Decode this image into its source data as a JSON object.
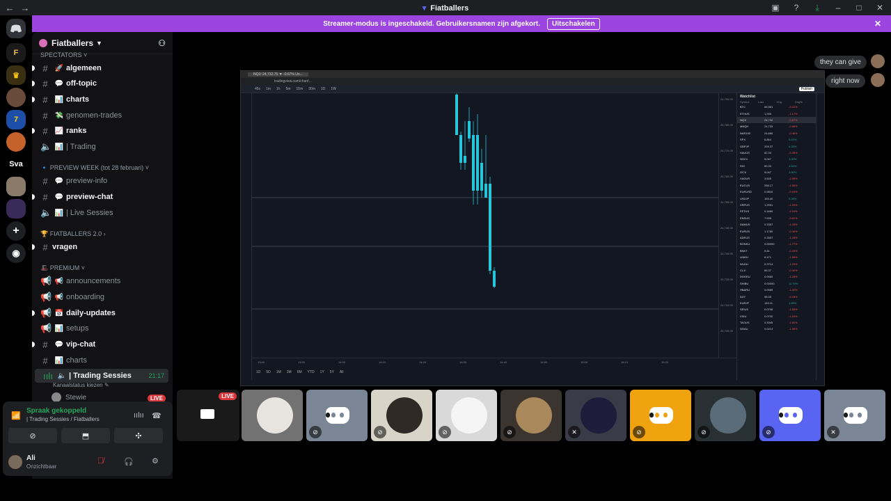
{
  "titlebar": {
    "back": "←",
    "forward": "→",
    "title": "Fiatballers",
    "icons": [
      "inbox-icon",
      "help-icon",
      "download-icon",
      "minimize-icon",
      "maximize-icon",
      "close-icon"
    ]
  },
  "banner": {
    "text": "Streamer-modus is ingeschakeld. Gebruikersnamen zijn afgekort.",
    "button": "Uitschakelen",
    "close": "✕"
  },
  "guilds": {
    "sva_label": "Sva"
  },
  "server": {
    "name": "Fiatballers"
  },
  "channels": {
    "cat_spectators": "SPECTATORS",
    "algemeen": "algemeen",
    "off_topic": "off-topic",
    "charts": "charts",
    "genomen_trades": "genomen-trades",
    "ranks": "ranks",
    "trading": "| Trading",
    "cat_preview": "PREVIEW WEEK (tot 28 februari)",
    "preview_info": "preview-info",
    "preview_chat": "preview-chat",
    "live_sessies": "| Live Sessies",
    "cat_fiatballers": "FIATBALLERS 2.0",
    "vragen": "vragen",
    "cat_premium": "PREMIUM",
    "announcements": "announcements",
    "onboarding": "onboarding",
    "daily_updates": "daily-updates",
    "setups": "setups",
    "vip_chat": "vip-chat",
    "charts2": "charts",
    "trading_sessies": "| Trading Sessies",
    "trading_sessies_time": "21:17",
    "kanaalstatus": "Kanaalstatus kiezen",
    "stewie": "Stewie",
    "live_badge": "LIVE"
  },
  "voice_panel": {
    "status": "Spraak gekoppeld",
    "location": "| Trading Sessies / Fiatballers",
    "user_name": "Ali",
    "user_status": "Onzichtbaar"
  },
  "chat_bubbles": [
    "they can give",
    "right now"
  ],
  "stream": {
    "tab_title": "NQ1! 24,732.75 ▼ -0.67% Un...",
    "url": "tradingview.com/chart/...",
    "timeframes": [
      "45s",
      "1m",
      "1h",
      "5m",
      "15m",
      "30m",
      "1D",
      "1W"
    ],
    "publish": "Publish",
    "watchlist_title": "Watchlist",
    "watch_cols": [
      "Symbol",
      "Last",
      "Chg",
      "Chg%"
    ],
    "price_labels": [
      "24,790.00",
      "24,780.00",
      "24,770.00",
      "24,760.00",
      "24,750.00",
      "24,740.00",
      "24,730.00",
      "24,720.00",
      "24,710.00",
      "24,700.00"
    ],
    "time_labels": [
      "13:40",
      "13:50",
      "14:00",
      "14:10",
      "14:20",
      "14:30",
      "14:40",
      "14:50",
      "15:00",
      "15:10",
      "15:20"
    ],
    "bottom_items": [
      "1D",
      "5D",
      "1M",
      "3M",
      "6M",
      "YTD",
      "1Y",
      "5Y",
      "All"
    ],
    "watchlist": [
      {
        "sym": "BTC",
        "last": "66,561",
        "chg": "-0.22%",
        "dir": "down"
      },
      {
        "sym": "ETHUS",
        "last": "1,935",
        "chg": "-1.17%",
        "dir": "down"
      },
      {
        "sym": "NQ1!",
        "last": "24,732",
        "chg": "-0.67%",
        "dir": "down",
        "sel": true
      },
      {
        "sym": "MNQH",
        "last": "24,733",
        "chg": "-0.66%",
        "dir": "down"
      },
      {
        "sym": "NAS100",
        "last": "24,680",
        "chg": "-0.46%",
        "dir": "down"
      },
      {
        "sym": "SPX",
        "last": "6,864",
        "chg": "0.63%",
        "dir": "up"
      },
      {
        "sym": "GBPJP",
        "last": "209.37",
        "chg": "0.33%",
        "dir": "up"
      },
      {
        "sym": "XAUUS",
        "last": "82.33",
        "chg": "-0.35%",
        "dir": "down"
      },
      {
        "sym": "NGC1",
        "last": "5,047",
        "chg": "1.00%",
        "dir": "up"
      },
      {
        "sym": "SI1!",
        "last": "80.30",
        "chg": "3.54%",
        "dir": "up"
      },
      {
        "sym": "GC1!",
        "last": "5,047",
        "chg": "1.00%",
        "dir": "up"
      },
      {
        "sym": "XAGUS",
        "last": "3,635",
        "chg": "-2.58%",
        "dir": "down"
      },
      {
        "sym": "EUCUS",
        "last": "256.17",
        "chg": "-1.56%",
        "dir": "down"
      },
      {
        "sym": "EURUSD",
        "last": "0.9816",
        "chg": "-0.94%",
        "dir": "down"
      },
      {
        "sym": "USDJP",
        "last": "155.40",
        "chg": "0.26%",
        "dir": "up"
      },
      {
        "sym": "XRPUS",
        "last": "1.2051",
        "chg": "-1.09%",
        "dir": "down"
      },
      {
        "sym": "FETUS",
        "last": "0.1680",
        "chg": "-1.04%",
        "dir": "down"
      },
      {
        "sym": "ENSUS",
        "last": "7.935",
        "chg": "-0.81%",
        "dir": "down"
      },
      {
        "sym": "DAMUS",
        "last": "0.3357",
        "chg": "-1.43%",
        "dir": "down"
      },
      {
        "sym": "EURUS",
        "last": "1.1780",
        "chg": "-0.06%",
        "dir": "down"
      },
      {
        "sym": "ADEUS",
        "last": "0.2897",
        "chg": "-1.43%",
        "dir": "down"
      },
      {
        "sym": "BONKU",
        "last": "0.00000",
        "chg": "-1.77%",
        "dir": "down"
      },
      {
        "sym": "BNKT",
        "last": "5.81",
        "chg": "-0.43%",
        "dir": "down"
      },
      {
        "sym": "LINKU",
        "last": "8.471",
        "chg": "-1.86%",
        "dir": "down"
      },
      {
        "sym": "WLDU",
        "last": "0.3714",
        "chg": "-1.29%",
        "dir": "down"
      },
      {
        "sym": "CL1!",
        "last": "66.37",
        "chg": "-0.40%",
        "dir": "down"
      },
      {
        "sym": "DOGEU",
        "last": "0.0960",
        "chg": "-1.28%",
        "dir": "down"
      },
      {
        "sym": "SHIBU",
        "last": "0.00000",
        "chg": "11.79%",
        "dir": "up"
      },
      {
        "sym": "HBARU",
        "last": "0.0989",
        "chg": "-1.30%",
        "dir": "down"
      },
      {
        "sym": "DXY",
        "last": "98.05",
        "chg": "-0.28%",
        "dir": "down"
      },
      {
        "sym": "EURJP",
        "last": "183.11",
        "chg": "1.85%",
        "dir": "up"
      },
      {
        "sym": "SEIUS",
        "last": "0.0708",
        "chg": "-1.58%",
        "dir": "down"
      },
      {
        "sym": "VIXU",
        "last": "0.0700",
        "chg": "-1.54%",
        "dir": "down"
      },
      {
        "sym": "TAOUS",
        "last": "0.3045",
        "chg": "-1.81%",
        "dir": "down"
      },
      {
        "sym": "GDAU",
        "last": "0.0214",
        "chg": "-1.96%",
        "dir": "down"
      }
    ]
  },
  "tiles": {
    "live_label": "LIVE",
    "participants": [
      {
        "type": "stream"
      },
      {
        "type": "avatar",
        "bg": "#727272",
        "av": "#e7e4e0",
        "mic": "none"
      },
      {
        "type": "discord",
        "bg": "#7a8696",
        "mic": "muted"
      },
      {
        "type": "avatar",
        "bg": "#d9d4c8",
        "av": "#2f2a25",
        "mic": "muted"
      },
      {
        "type": "avatar",
        "bg": "#d9d9d9",
        "av": "#f5f5f5",
        "mic": "muted"
      },
      {
        "type": "avatar",
        "bg": "#3b342f",
        "av": "#a9895c",
        "mic": "muted"
      },
      {
        "type": "avatar",
        "bg": "#3a3b48",
        "av": "#1f1b3a",
        "mic": "deaf"
      },
      {
        "type": "discord",
        "bg": "#f0a20f",
        "mic": "muted"
      },
      {
        "type": "avatar",
        "bg": "#2a3134",
        "av": "#5a6b7a",
        "mic": "muted"
      },
      {
        "type": "discord",
        "bg": "#5865f2",
        "mic": "muted"
      },
      {
        "type": "discord",
        "bg": "#7a8696",
        "mic": "deaf"
      }
    ]
  },
  "colors": {
    "brand": "#5865f2",
    "banner": "#9b44e0",
    "live": "#da373c",
    "connected": "#23a55a",
    "candle": "#26c6da"
  }
}
